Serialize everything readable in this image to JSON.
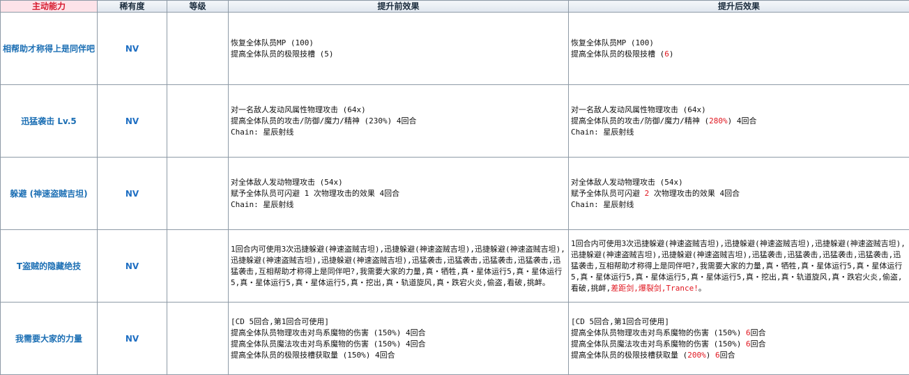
{
  "headers": {
    "active": "主动能力",
    "rarity": "稀有度",
    "level": "等级",
    "before": "提升前效果",
    "after": "提升后效果"
  },
  "rows": [
    {
      "name": "相帮助才称得上是同伴吧",
      "rarity": "NV",
      "level": "",
      "before": [
        "恢复全体队员MP (100)",
        "提高全体队员的极限技槽 (5)"
      ],
      "after": [
        [
          {
            "t": "恢复全体队员MP (100)"
          }
        ],
        [
          {
            "t": "提高全体队员的极限技槽 ("
          },
          {
            "t": "6",
            "hl": true
          },
          {
            "t": ")"
          }
        ]
      ]
    },
    {
      "name": "迅猛袭击 Lv.5",
      "rarity": "NV",
      "level": "",
      "before": [
        "对一名敌人发动风属性物理攻击 (64x)",
        "提高全体队员的攻击/防御/魔力/精神 (230%) 4回合",
        "Chain: 星辰射线"
      ],
      "after": [
        [
          {
            "t": "对一名敌人发动风属性物理攻击 (64x)"
          }
        ],
        [
          {
            "t": "提高全体队员的攻击/防御/魔力/精神 ("
          },
          {
            "t": "280%",
            "hl": true
          },
          {
            "t": ") 4回合"
          }
        ],
        [
          {
            "t": "Chain: 星辰射线"
          }
        ]
      ]
    },
    {
      "name": "躲避 (神速盗贼吉坦)",
      "rarity": "NV",
      "level": "",
      "before": [
        "对全体敌人发动物理攻击 (54x)",
        "赋予全体队员可闪避 1 次物理攻击的效果 4回合",
        "Chain: 星辰射线"
      ],
      "after": [
        [
          {
            "t": "对全体敌人发动物理攻击 (54x)"
          }
        ],
        [
          {
            "t": "赋予全体队员可闪避 "
          },
          {
            "t": "2",
            "hl": true
          },
          {
            "t": " 次物理攻击的效果 4回合"
          }
        ],
        [
          {
            "t": "Chain: 星辰射线"
          }
        ]
      ]
    },
    {
      "name": "T盗贼的隐藏绝技",
      "rarity": "NV",
      "level": "",
      "before": [
        "1回合内可使用3次迅捷躲避(神速盗贼吉坦),迅捷躲避(神速盗贼吉坦),迅捷躲避(神速盗贼吉坦),迅捷躲避(神速盗贼吉坦),迅捷躲避(神速盗贼吉坦),迅猛袭击,迅猛袭击,迅猛袭击,迅猛袭击,迅猛袭击,互相帮助才称得上是同伴吧?,我需要大家的力量,真・牺牲,真・星体运行5,真・星体运行5,真・星体运行5,真・星体运行5,真・挖出,真・轨道旋风,真・跌宕火炎,偷盗,看破,挑衅。"
      ],
      "after": [
        [
          {
            "t": "1回合内可使用3次迅捷躲避(神速盗贼吉坦),迅捷躲避(神速盗贼吉坦),迅捷躲避(神速盗贼吉坦),迅捷躲避(神速盗贼吉坦),迅捷躲避(神速盗贼吉坦),迅猛袭击,迅猛袭击,迅猛袭击,迅猛袭击,迅猛袭击,互相帮助才称得上是同伴吧?,我需要大家的力量,真・牺牲,真・星体运行5,真・星体运行5,真・星体运行5,真・星体运行5,真・星体运行5,真・挖出,真・轨道旋风,真・跌宕火炎,偷盗,看破,挑衅,"
          },
          {
            "t": "差距剑,爆裂剑,Trance!",
            "hl": true
          },
          {
            "t": "。"
          }
        ]
      ]
    },
    {
      "name": "我需要大家的力量",
      "rarity": "NV",
      "level": "",
      "before": [
        "[CD 5回合,第1回合可使用]",
        "提高全体队员物理攻击对鸟系魔物的伤害 (150%) 4回合",
        "提高全体队员魔法攻击对鸟系魔物的伤害 (150%) 4回合",
        "提高全体队员的极限技槽获取量 (150%) 4回合"
      ],
      "after": [
        [
          {
            "t": "[CD 5回合,第1回合可使用]"
          }
        ],
        [
          {
            "t": "提高全体队员物理攻击对鸟系魔物的伤害 (150%) "
          },
          {
            "t": "6",
            "hl": true
          },
          {
            "t": "回合"
          }
        ],
        [
          {
            "t": "提高全体队员魔法攻击对鸟系魔物的伤害 (150%) "
          },
          {
            "t": "6",
            "hl": true
          },
          {
            "t": "回合"
          }
        ],
        [
          {
            "t": "提高全体队员的极限技槽获取量 ("
          },
          {
            "t": "200%",
            "hl": true
          },
          {
            "t": ") "
          },
          {
            "t": "6",
            "hl": true
          },
          {
            "t": "回合"
          }
        ]
      ]
    }
  ]
}
